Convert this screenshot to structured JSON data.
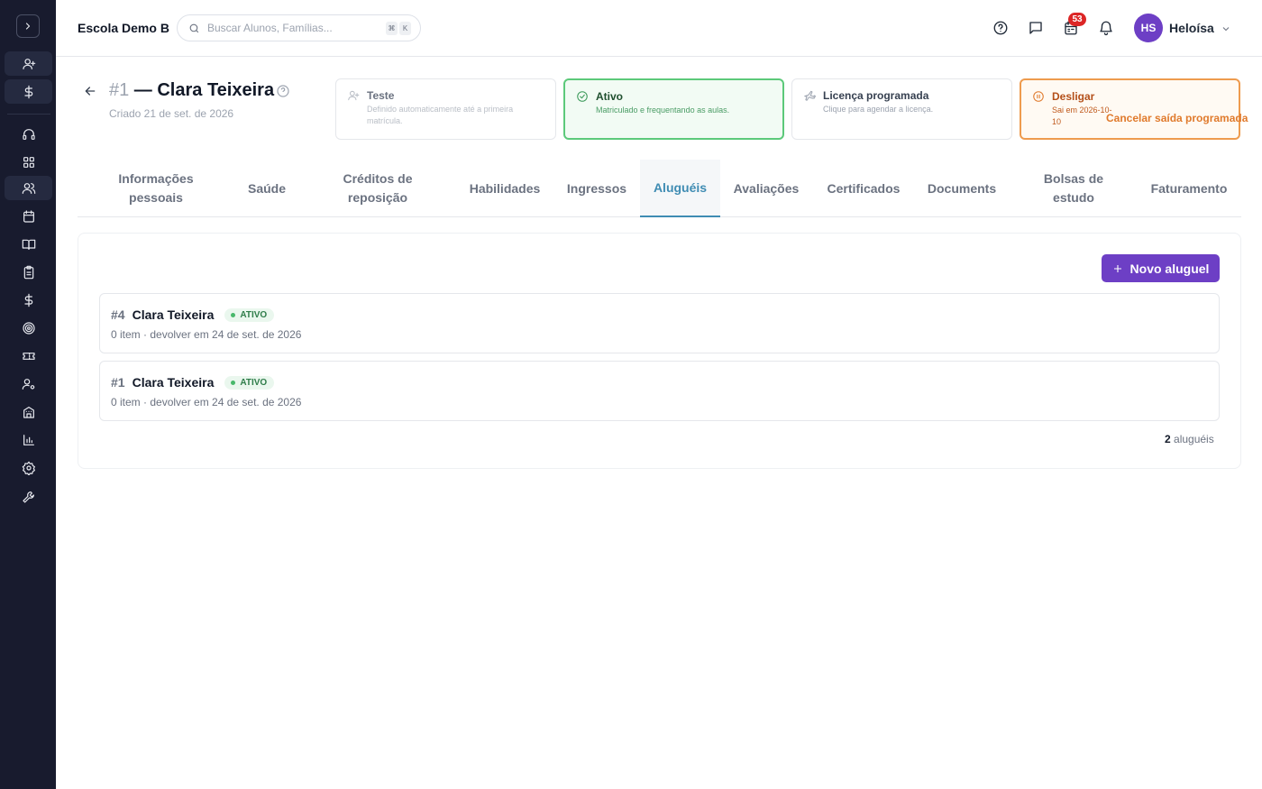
{
  "topbar": {
    "school_name": "Escola Demo B",
    "search_placeholder": "Buscar Alunos, Famílias...",
    "shortcut_key_1": "⌘",
    "shortcut_key_2": "K",
    "notification_count": "53",
    "user_initials": "HS",
    "user_name": "Heloísa"
  },
  "student": {
    "number": "#1",
    "title": " — Clara Teixeira",
    "created": "Criado 21 de set. de 2026"
  },
  "status_cards": {
    "teste": {
      "title": "Teste",
      "desc": "Definido automaticamente até a primeira matrícula."
    },
    "ativo": {
      "title": "Ativo",
      "desc": "Matriculado e frequentando as aulas."
    },
    "licenca": {
      "title": "Licença programada",
      "desc": "Clique para agendar a licença."
    },
    "desligar": {
      "title": "Desligar",
      "desc": "Sai em 2026-10-10",
      "cancel_label": "Cancelar saída programada"
    }
  },
  "tabs": [
    {
      "label": "Informações pessoais"
    },
    {
      "label": "Saúde"
    },
    {
      "label": "Créditos de reposição"
    },
    {
      "label": "Habilidades"
    },
    {
      "label": "Ingressos"
    },
    {
      "label": "Aluguéis"
    },
    {
      "label": "Avaliações"
    },
    {
      "label": "Certificados"
    },
    {
      "label": "Documents"
    },
    {
      "label": "Bolsas de estudo"
    },
    {
      "label": "Faturamento"
    }
  ],
  "active_tab": "Aluguéis",
  "rentals": {
    "new_button_label": "Novo aluguel",
    "items": [
      {
        "number": "#4",
        "name": "Clara Teixeira",
        "status": "ATIVO",
        "details": "0 item · devolver em 24 de set. de 2026"
      },
      {
        "number": "#1",
        "name": "Clara Teixeira",
        "status": "ATIVO",
        "details": "0 item · devolver em 24 de set. de 2026"
      }
    ],
    "count": "2",
    "count_label": " aluguéis"
  },
  "colors": {
    "sidebar_bg": "#181b2e",
    "accent_purple": "#6d3fc5",
    "tab_active": "#3f8cb3",
    "status_active_green": "#5cc97a",
    "status_leave_orange": "#ee9b4e",
    "badge_red": "#dc2626"
  },
  "icons": {
    "sidebar": [
      "chevron-right-icon",
      "user-plus-icon",
      "dollar-icon",
      "headset-icon",
      "grid-icon",
      "users-icon",
      "calendar-icon",
      "book-open-icon",
      "clipboard-icon",
      "dollar-icon",
      "target-icon",
      "ticket-icon",
      "user-cog-icon",
      "building-icon",
      "bar-chart-icon",
      "settings-icon",
      "wrench-icon"
    ],
    "topbar": [
      "search-icon",
      "help-icon",
      "chat-icon",
      "calendar-badge-icon",
      "bell-icon",
      "chevron-down-icon"
    ]
  }
}
